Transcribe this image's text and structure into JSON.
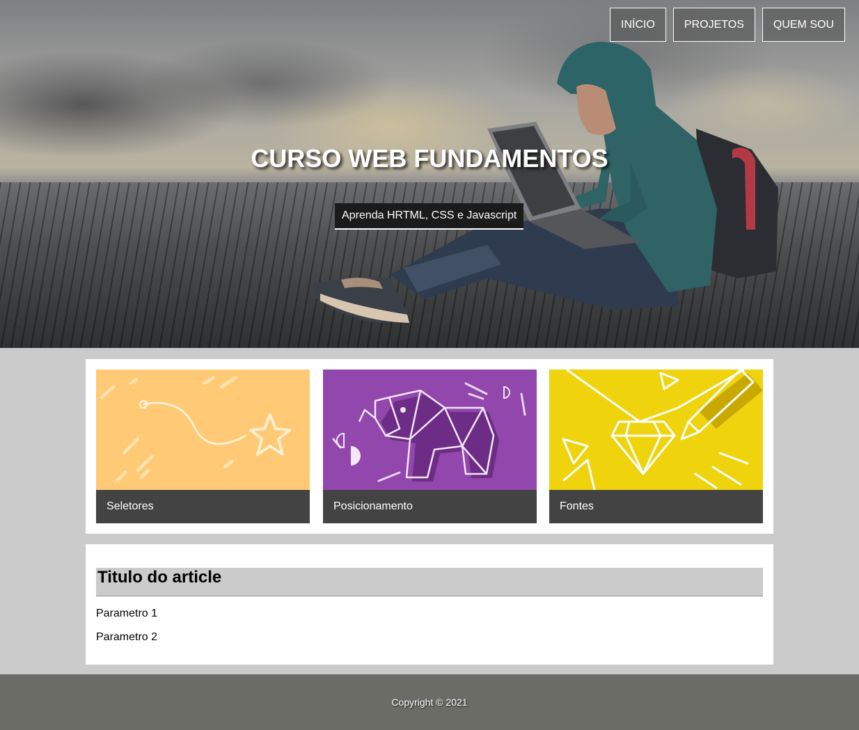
{
  "nav": {
    "items": [
      {
        "label": "INÍCIO"
      },
      {
        "label": "PROJETOS"
      },
      {
        "label": "QUEM SOU"
      }
    ]
  },
  "hero": {
    "title": "CURSO WEB FUNDAMENTOS",
    "subtitle": "Aprenda HRTML, CSS e Javascript"
  },
  "cards": [
    {
      "label": "Seletores",
      "color": "#ffc975",
      "icon": "star-path-icon"
    },
    {
      "label": "Posicionamento",
      "color": "#9147ab",
      "icon": "origami-elephant-icon"
    },
    {
      "label": "Fontes",
      "color": "#efd30d",
      "icon": "diamond-pencil-icon"
    }
  ],
  "article": {
    "title": "Titulo do article",
    "params": [
      "Parametro 1",
      "Parametro 2"
    ]
  },
  "footer": {
    "copyright": "Copyright © 2021"
  },
  "colors": {
    "page_background": "#cbcbcb",
    "card_label_background": "#434343",
    "footer_background": "#6c6c67"
  }
}
